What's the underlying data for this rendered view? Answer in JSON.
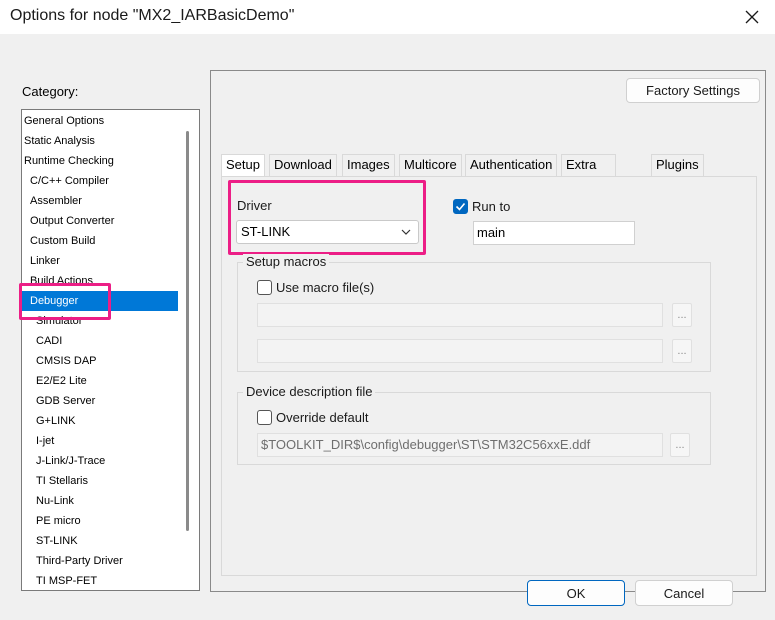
{
  "window": {
    "title": "Options for node \"MX2_IARBasicDemo\""
  },
  "category": {
    "label": "Category:",
    "items": [
      "General Options",
      "Static Analysis",
      "Runtime Checking",
      "C/C++ Compiler",
      "Assembler",
      "Output Converter",
      "Custom Build",
      "Linker",
      "Build Actions",
      "Debugger",
      "Simulator",
      "CADI",
      "CMSIS DAP",
      "E2/E2 Lite",
      "GDB Server",
      "G+LINK",
      "I-jet",
      "J-Link/J-Trace",
      "TI Stellaris",
      "Nu-Link",
      "PE micro",
      "ST-LINK",
      "Third-Party Driver",
      "TI MSP-FET"
    ],
    "selected": "Debugger"
  },
  "buttons": {
    "factory": "Factory Settings",
    "ok": "OK",
    "cancel": "Cancel"
  },
  "tabs": [
    "Setup",
    "Download",
    "Images",
    "Multicore",
    "Authentication",
    "Extra Options",
    "Plugins"
  ],
  "setup": {
    "driver_label": "Driver",
    "driver_value": "ST-LINK",
    "run_to_label": "Run to",
    "run_to_checked": true,
    "run_to_value": "main",
    "macros_title": "Setup macros",
    "use_macro_label": "Use macro file(s)",
    "device_title": "Device description file",
    "override_label": "Override default",
    "device_path": "$TOOLKIT_DIR$\\config\\debugger\\ST\\STM32C56xxE.ddf",
    "browse": "..."
  },
  "colors": {
    "accent": "#0078d7",
    "highlight": "#ec1e86"
  }
}
